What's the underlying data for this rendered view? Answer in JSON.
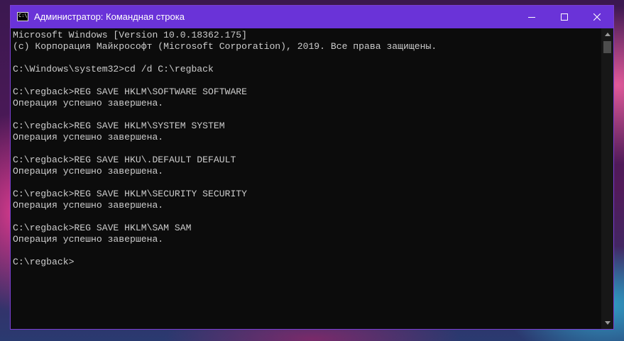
{
  "window": {
    "title": "Администратор: Командная строка",
    "icon_label": "C:\\"
  },
  "icons": {
    "app": "console-icon",
    "minimize": "minimize-icon",
    "maximize": "maximize-icon",
    "close": "close-icon",
    "scroll_up": "scroll-up-arrow-icon",
    "scroll_down": "scroll-down-arrow-icon"
  },
  "colors": {
    "titlebar": "#6a33d8",
    "console_bg": "#0c0c0c",
    "console_text": "#cccccc"
  },
  "console": {
    "lines": [
      "Microsoft Windows [Version 10.0.18362.175]",
      "(c) Корпорация Майкрософт (Microsoft Corporation), 2019. Все права защищены.",
      "",
      "C:\\Windows\\system32>cd /d C:\\regback",
      "",
      "C:\\regback>REG SAVE HKLM\\SOFTWARE SOFTWARE",
      "Операция успешно завершена.",
      "",
      "C:\\regback>REG SAVE HKLM\\SYSTEM SYSTEM",
      "Операция успешно завершена.",
      "",
      "C:\\regback>REG SAVE HKU\\.DEFAULT DEFAULT",
      "Операция успешно завершена.",
      "",
      "C:\\regback>REG SAVE HKLM\\SECURITY SECURITY",
      "Операция успешно завершена.",
      "",
      "C:\\regback>REG SAVE HKLM\\SAM SAM",
      "Операция успешно завершена.",
      "",
      "C:\\regback>"
    ]
  }
}
